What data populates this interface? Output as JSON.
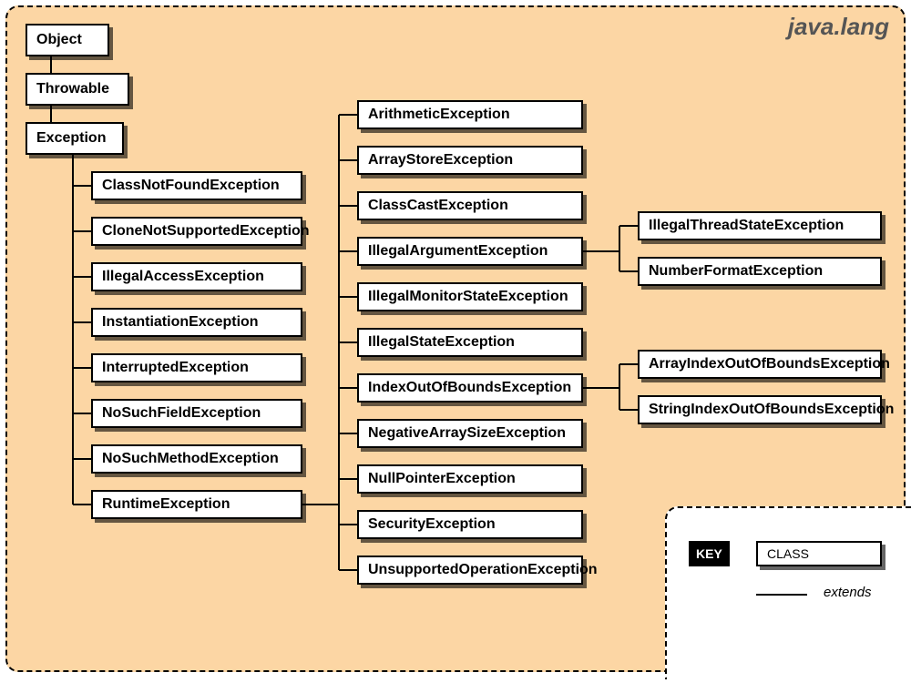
{
  "package": "java.lang",
  "root": "Object",
  "throwable": "Throwable",
  "exception": "Exception",
  "exception_children": [
    "ClassNotFoundException",
    "CloneNotSupportedException",
    "IllegalAccessException",
    "InstantiationException",
    "InterruptedException",
    "NoSuchFieldException",
    "NoSuchMethodException",
    "RuntimeException"
  ],
  "runtime_children": [
    "ArithmeticException",
    "ArrayStoreException",
    "ClassCastException",
    "IllegalArgumentException",
    "IllegalMonitorStateException",
    "IllegalStateException",
    "IndexOutOfBoundsException",
    "NegativeArraySizeException",
    "NullPointerException",
    "SecurityException",
    "UnsupportedOperationException"
  ],
  "illegal_argument_children": [
    "IllegalThreadStateException",
    "NumberFormatException"
  ],
  "index_oob_children": [
    "ArrayIndexOutOfBoundsException",
    "StringIndexOutOfBoundsException"
  ],
  "key": {
    "label": "KEY",
    "class_label": "CLASS",
    "extends_label": "extends"
  }
}
